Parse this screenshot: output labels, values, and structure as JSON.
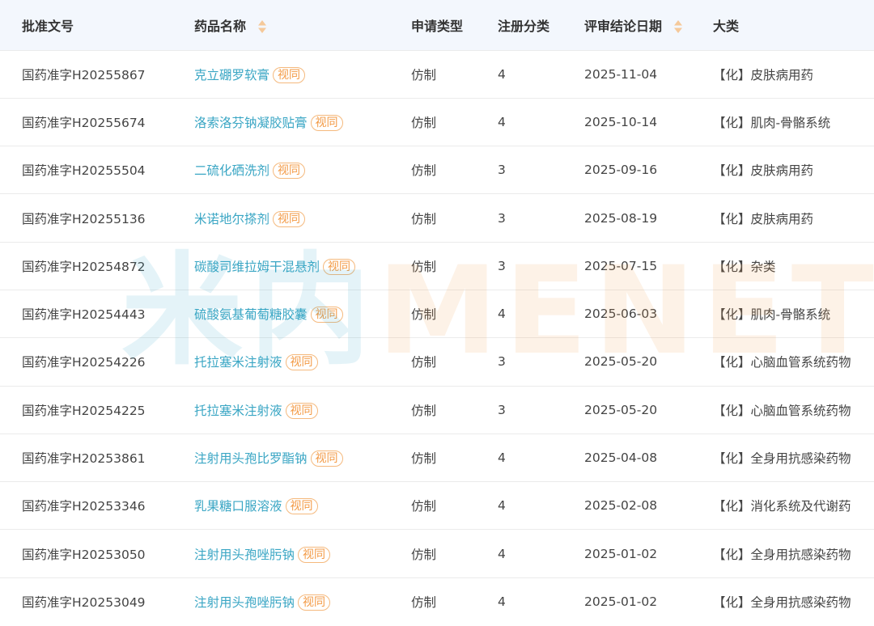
{
  "table": {
    "headers": {
      "approval_no": "批准文号",
      "drug_name": "药品名称",
      "apply_type": "申请类型",
      "reg_class": "注册分类",
      "review_date": "评审结论日期",
      "category": "大类"
    },
    "rows": [
      {
        "approval_no": "国药准字H20255867",
        "drug_name": "克立硼罗软膏",
        "tag": "视同",
        "apply_type": "仿制",
        "reg_class": "4",
        "review_date": "2025-11-04",
        "category": "【化】皮肤病用药"
      },
      {
        "approval_no": "国药准字H20255674",
        "drug_name": "洛索洛芬钠凝胶贴膏",
        "tag": "视同",
        "apply_type": "仿制",
        "reg_class": "4",
        "review_date": "2025-10-14",
        "category": "【化】肌肉-骨骼系统"
      },
      {
        "approval_no": "国药准字H20255504",
        "drug_name": "二硫化硒洗剂",
        "tag": "视同",
        "apply_type": "仿制",
        "reg_class": "3",
        "review_date": "2025-09-16",
        "category": "【化】皮肤病用药"
      },
      {
        "approval_no": "国药准字H20255136",
        "drug_name": "米诺地尔搽剂",
        "tag": "视同",
        "apply_type": "仿制",
        "reg_class": "3",
        "review_date": "2025-08-19",
        "category": "【化】皮肤病用药"
      },
      {
        "approval_no": "国药准字H20254872",
        "drug_name": "碳酸司维拉姆干混悬剂",
        "tag": "视同",
        "apply_type": "仿制",
        "reg_class": "3",
        "review_date": "2025-07-15",
        "category": "【化】杂类"
      },
      {
        "approval_no": "国药准字H20254443",
        "drug_name": "硫酸氨基葡萄糖胶囊",
        "tag": "视同",
        "apply_type": "仿制",
        "reg_class": "4",
        "review_date": "2025-06-03",
        "category": "【化】肌肉-骨骼系统"
      },
      {
        "approval_no": "国药准字H20254226",
        "drug_name": "托拉塞米注射液",
        "tag": "视同",
        "apply_type": "仿制",
        "reg_class": "3",
        "review_date": "2025-05-20",
        "category": "【化】心脑血管系统药物"
      },
      {
        "approval_no": "国药准字H20254225",
        "drug_name": "托拉塞米注射液",
        "tag": "视同",
        "apply_type": "仿制",
        "reg_class": "3",
        "review_date": "2025-05-20",
        "category": "【化】心脑血管系统药物"
      },
      {
        "approval_no": "国药准字H20253861",
        "drug_name": "注射用头孢比罗酯钠",
        "tag": "视同",
        "apply_type": "仿制",
        "reg_class": "4",
        "review_date": "2025-04-08",
        "category": "【化】全身用抗感染药物"
      },
      {
        "approval_no": "国药准字H20253346",
        "drug_name": "乳果糖口服溶液",
        "tag": "视同",
        "apply_type": "仿制",
        "reg_class": "4",
        "review_date": "2025-02-08",
        "category": "【化】消化系统及代谢药"
      },
      {
        "approval_no": "国药准字H20253050",
        "drug_name": "注射用头孢唑肟钠",
        "tag": "视同",
        "apply_type": "仿制",
        "reg_class": "4",
        "review_date": "2025-01-02",
        "category": "【化】全身用抗感染药物"
      },
      {
        "approval_no": "国药准字H20253049",
        "drug_name": "注射用头孢唑肟钠",
        "tag": "视同",
        "apply_type": "仿制",
        "reg_class": "4",
        "review_date": "2025-01-02",
        "category": "【化】全身用抗感染药物"
      }
    ]
  },
  "watermark": {
    "cn": "米内",
    "en": "MENET"
  },
  "icons": {
    "sort": "sort-icon"
  },
  "colors": {
    "link": "#3aa6c4",
    "tag": "#f39a45",
    "header_bg": "#f3f7fd",
    "sort_icon": "#f5c99a"
  }
}
